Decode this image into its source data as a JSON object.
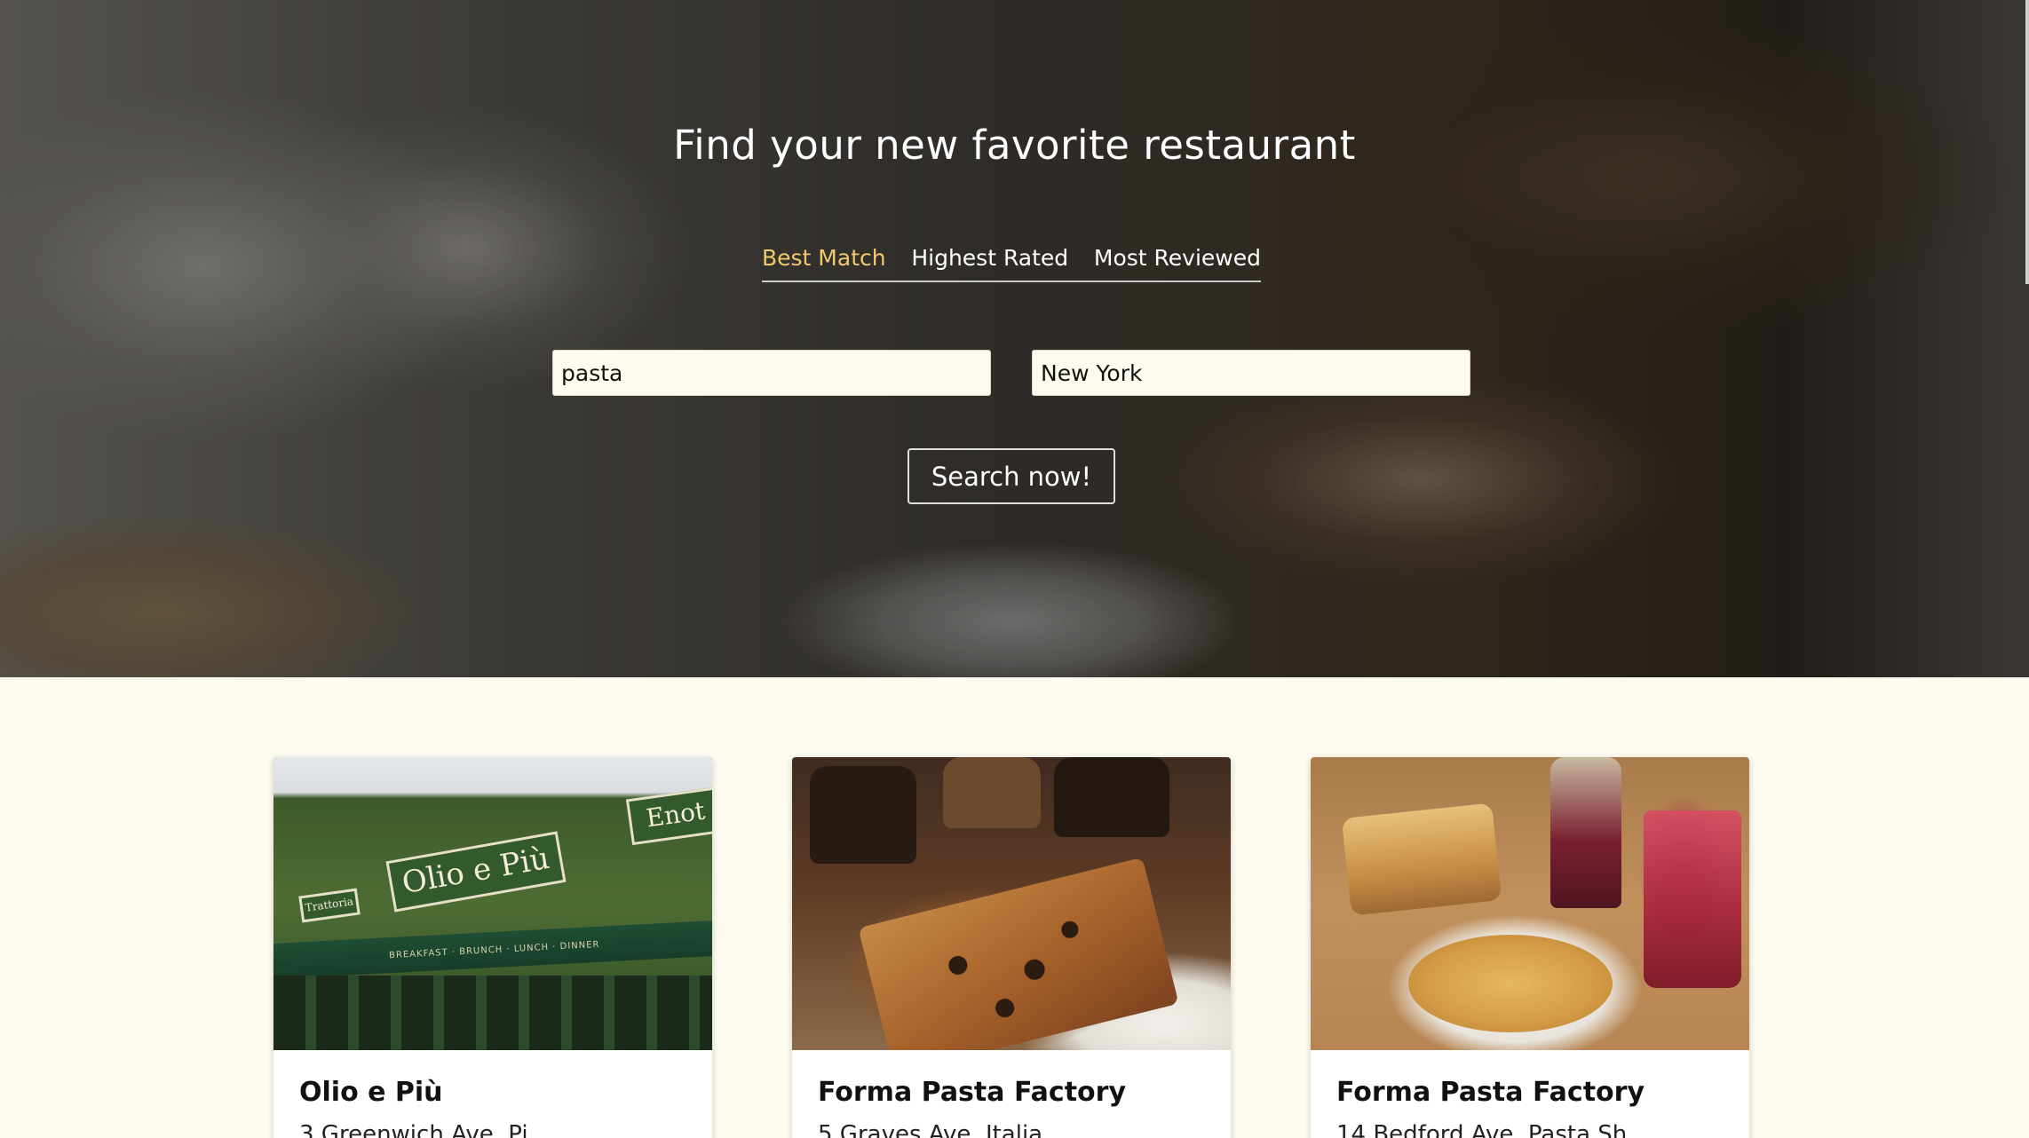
{
  "hero": {
    "title": "Find your new favorite restaurant",
    "sort_tabs": [
      {
        "label": "Best Match",
        "active": true
      },
      {
        "label": "Highest Rated",
        "active": false
      },
      {
        "label": "Most Reviewed",
        "active": false
      }
    ],
    "search_terms": {
      "value": "pasta"
    },
    "location": {
      "value": "New York"
    },
    "search_button": "Search now!"
  },
  "colors": {
    "page_background": "#fdfbef",
    "active_tab": "#f2c86a",
    "card_background": "#ffffff"
  },
  "results": [
    {
      "name": "Olio e Più",
      "address": "3 Greenwich Ave, Pi"
    },
    {
      "name": "Forma Pasta Factory",
      "address": "5 Graves Ave, Italia"
    },
    {
      "name": "Forma Pasta Factory",
      "address": "14 Bedford Ave, Pasta Sh"
    }
  ],
  "image_signs": {
    "main": "Olio e Più",
    "side": "Enot",
    "small": "Trattoria",
    "awning": "BREAKFAST · BRUNCH · LUNCH · DINNER"
  }
}
